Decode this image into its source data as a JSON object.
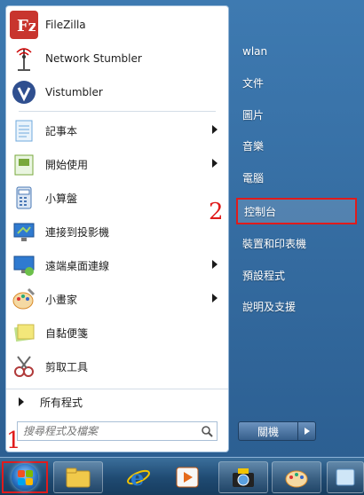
{
  "start_menu": {
    "pinned": [
      {
        "label": "FileZilla",
        "icon": "filezilla-icon",
        "color": "#c8352e"
      },
      {
        "label": "Network Stumbler",
        "icon": "antenna-icon",
        "color": "#707070"
      },
      {
        "label": "Vistumbler",
        "icon": "vistumbler-icon",
        "color": "#2f4f8f"
      },
      {
        "label": "記事本",
        "icon": "notepad-icon",
        "color": "#6fa8dc"
      },
      {
        "label": "開始使用",
        "icon": "getting-started-icon",
        "color": "#78a83b"
      },
      {
        "label": "小算盤",
        "icon": "calculator-icon",
        "color": "#4a78b5"
      },
      {
        "label": "連接到投影機",
        "icon": "projector-icon",
        "color": "#2f7ad0"
      },
      {
        "label": "遠端桌面連線",
        "icon": "remote-desktop-icon",
        "color": "#2f7ad0"
      },
      {
        "label": "小畫家",
        "icon": "paint-icon",
        "color": "#d98b2b"
      },
      {
        "label": "自黏便箋",
        "icon": "sticky-notes-icon",
        "color": "#e4d46a"
      },
      {
        "label": "剪取工具",
        "icon": "snipping-tool-icon",
        "color": "#b03a3a"
      }
    ],
    "all_programs": "所有程式",
    "search_placeholder": "搜尋程式及檔案"
  },
  "right_pane": {
    "items": [
      "wlan",
      "文件",
      "圖片",
      "音樂",
      "電腦",
      "控制台",
      "裝置和印表機",
      "預設程式",
      "說明及支援"
    ],
    "highlighted": "控制台"
  },
  "shutdown": {
    "label": "關機"
  },
  "markers": {
    "one": "1",
    "two": "2"
  },
  "colors": {
    "highlight_border": "#e01b1b"
  }
}
